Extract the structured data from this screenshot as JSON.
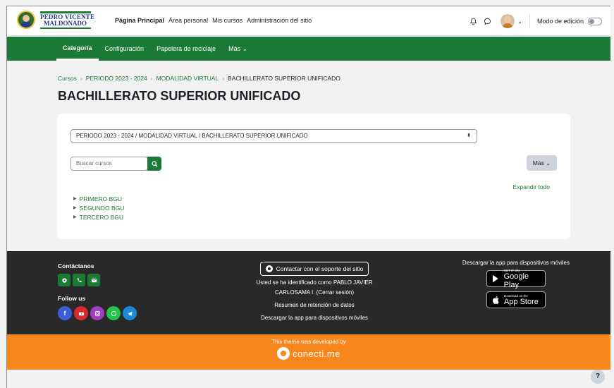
{
  "site": {
    "logo_line1": "PEDRO VICENTE",
    "logo_line2": "MALDONADO"
  },
  "primary_nav": [
    {
      "label": "Página Principal",
      "active": true
    },
    {
      "label": "Área personal",
      "active": false
    },
    {
      "label": "Mis cursos",
      "active": false
    },
    {
      "label": "Administración del sitio",
      "active": false
    }
  ],
  "user_menu": {
    "edit_mode_label": "Modo de edición",
    "edit_mode_on": false
  },
  "secondary_nav": [
    {
      "label": "Categoría",
      "active": true
    },
    {
      "label": "Configuración",
      "active": false
    },
    {
      "label": "Papelera de reciclaje",
      "active": false
    },
    {
      "label": "Más ⌄",
      "active": false
    }
  ],
  "breadcrumb": [
    {
      "label": "Cursos",
      "link": true
    },
    {
      "label": "PERIODO 2023 - 2024",
      "link": true
    },
    {
      "label": "MODALIDAD VIRTUAL",
      "link": true
    },
    {
      "label": "BACHILLERATO SUPERIOR UNIFICADO",
      "link": false
    }
  ],
  "page_title": "BACHILLERATO SUPERIOR UNIFICADO",
  "category_select": {
    "selected": "PERIODO 2023 - 2024 / MODALIDAD VIRTUAL / BACHILLERATO SUPERIOR UNIFICADO"
  },
  "search": {
    "placeholder": "Buscar cursos"
  },
  "more_button": "Más ⌄",
  "expand_all": "Expandir todo",
  "categories": [
    "PRIMERO BGU",
    "SEGUNDO BGU",
    "TERCERO BGU"
  ],
  "footer": {
    "contact_heading": "Contáctanos",
    "follow_heading": "Follow us",
    "support_button": "Contactar con el soporte del sitio",
    "logged_in_text": "Usted se ha identificado como PABLO JAVIER CARLOSAMA I. (Cerrar sesión)",
    "data_retention": "Resumen de retención de datos",
    "get_app": "Descargar la app para dispositivos móviles",
    "app_heading": "Descargar la app para dispositivos móviles",
    "google_play_small": "GET IT ON",
    "google_play_big": "Google Play",
    "app_store_small": "Download on the",
    "app_store_big": "App Store"
  },
  "credit": {
    "line": "This theme was developed by",
    "brand": "conecti.me"
  },
  "colors": {
    "green": "#1b7a36",
    "orange": "#f7861c",
    "footer_bg": "#292929"
  }
}
